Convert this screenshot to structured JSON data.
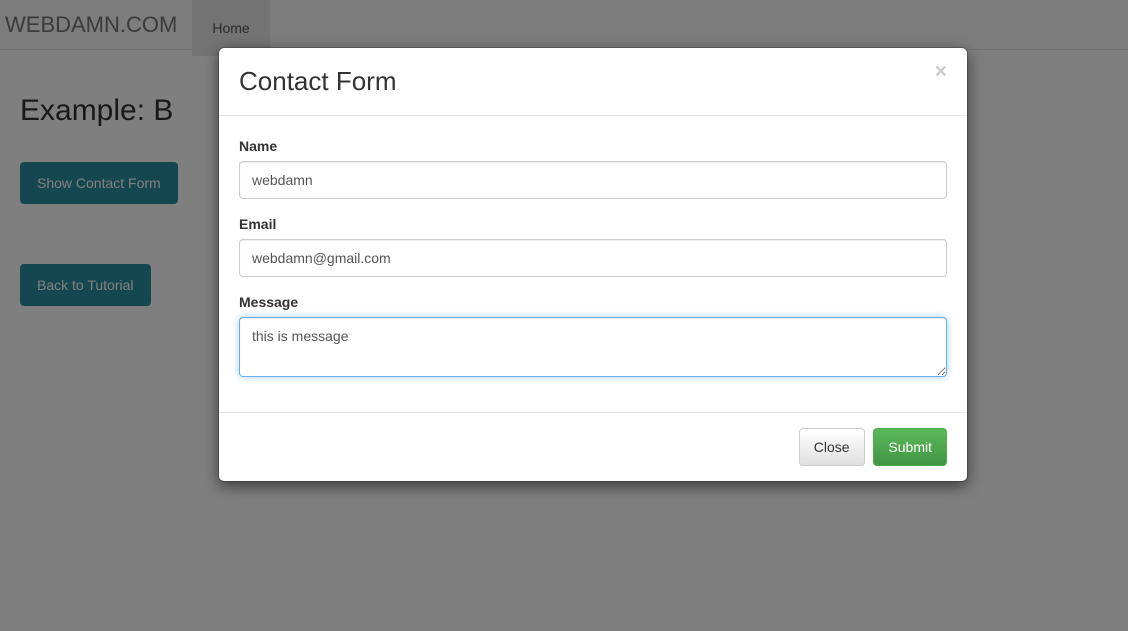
{
  "navbar": {
    "brand": "WEBDAMN.COM",
    "home_label": "Home"
  },
  "page": {
    "heading_prefix": "Example: B",
    "show_form_button": "Show Contact Form",
    "back_button": "Back to Tutorial"
  },
  "modal": {
    "title": "Contact Form",
    "close_symbol": "×",
    "form": {
      "name": {
        "label": "Name",
        "value": "webdamn"
      },
      "email": {
        "label": "Email",
        "value": "webdamn@gmail.com"
      },
      "message": {
        "label": "Message",
        "value": "this is message"
      }
    },
    "footer": {
      "close_label": "Close",
      "submit_label": "Submit"
    }
  }
}
